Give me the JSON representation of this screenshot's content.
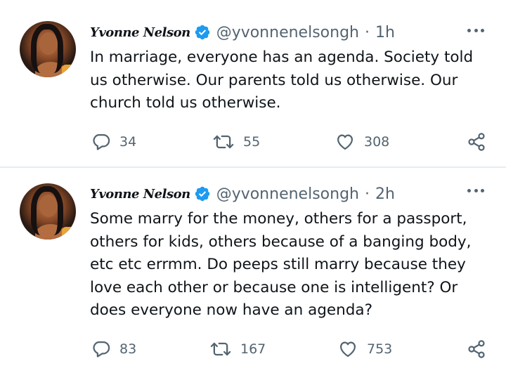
{
  "tweets": [
    {
      "name": "Yvonne Nelson",
      "handle": "@yvonnenelsongh",
      "separator": "·",
      "time": "1h",
      "text": "In marriage, everyone has an agenda. Society told us otherwise. Our parents told us otherwise. Our church told us otherwise.",
      "replies": "34",
      "retweets": "55",
      "likes": "308"
    },
    {
      "name": "Yvonne Nelson",
      "handle": "@yvonnenelsongh",
      "separator": "·",
      "time": "2h",
      "text": "Some marry for the money, others for a passport, others for kids, others because of a banging body, etc etc errmm. Do peeps still marry because they love each other or because one is intelligent? Or does everyone now have  an agenda?",
      "replies": "83",
      "retweets": "167",
      "likes": "753"
    }
  ],
  "icons": {
    "verified": "verified-badge-icon",
    "reply": "reply-icon",
    "retweet": "retweet-icon",
    "like": "heart-icon",
    "share": "share-icon",
    "more": "more-options-icon"
  },
  "colors": {
    "verified_blue": "#1d9bf0",
    "secondary_text": "#536471",
    "primary_text": "#0f1419",
    "divider": "#e6ecf0"
  }
}
